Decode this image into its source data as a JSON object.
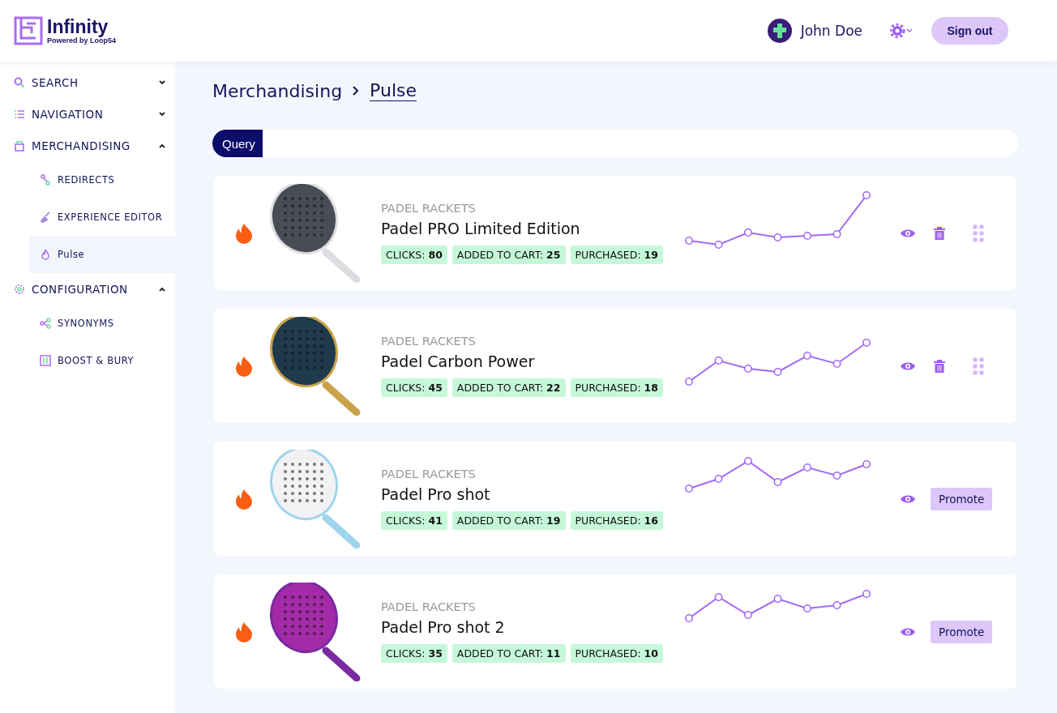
{
  "header": {
    "logo": {
      "name": "Infinity",
      "tagline": "Powered by Loop54"
    },
    "user": "John Doe",
    "sign_out": "Sign out"
  },
  "sidebar": {
    "items": [
      {
        "label": "SEARCH",
        "expanded": false
      },
      {
        "label": "NAVIGATION",
        "expanded": false
      },
      {
        "label": "MERCHANDISING",
        "expanded": true,
        "children": [
          {
            "label": "REDIRECTS",
            "selected": false
          },
          {
            "label": "EXPERIENCE EDITOR",
            "selected": false
          },
          {
            "label": "Pulse",
            "selected": true
          }
        ]
      },
      {
        "label": "CONFIGURATION",
        "expanded": true,
        "children": [
          {
            "label": "SYNONYMS",
            "selected": false
          },
          {
            "label": "BOOST & BURY",
            "selected": false
          }
        ]
      }
    ]
  },
  "breadcrumb": [
    "Merchandising",
    "Pulse"
  ],
  "tabs": [
    {
      "label": "Query",
      "selected": true
    }
  ],
  "products": [
    {
      "kind": "tracked",
      "category": "PADEL RACKETS",
      "name": "Padel PRO Limited Edition",
      "stats": [
        {
          "label": "CLICKS:",
          "value": "80"
        },
        {
          "label": "ADDED TO CART:",
          "value": "25"
        },
        {
          "label": "PURCHASED:",
          "value": "19"
        }
      ]
    },
    {
      "kind": "tracked",
      "category": "PADEL RACKETS",
      "name": "Padel Carbon Power",
      "stats": [
        {
          "label": "CLICKS:",
          "value": "45"
        },
        {
          "label": "ADDED TO CART:",
          "value": "22"
        },
        {
          "label": "PURCHASED:",
          "value": "18"
        }
      ]
    },
    {
      "kind": "promotable",
      "category": "PADEL RACKETS",
      "name": "Padel Pro shot",
      "promote": "Promote",
      "stats": [
        {
          "label": "CLICKS:",
          "value": "41"
        },
        {
          "label": "ADDED TO CART:",
          "value": "19"
        },
        {
          "label": "PURCHASED:",
          "value": "16"
        }
      ]
    },
    {
      "kind": "promotable",
      "category": "PADEL RACKETS",
      "name": "Padel Pro shot 2",
      "promote": "Promote",
      "stats": [
        {
          "label": "CLICKS:",
          "value": "35"
        },
        {
          "label": "ADDED TO CART:",
          "value": "11"
        },
        {
          "label": "PURCHASED:",
          "value": "10"
        }
      ]
    }
  ]
}
